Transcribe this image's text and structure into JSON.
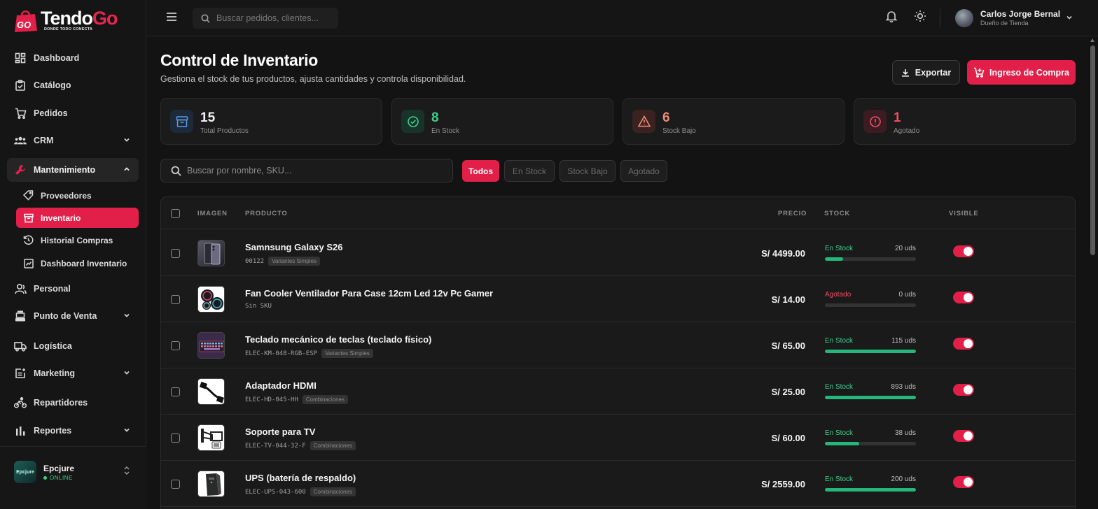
{
  "brand": {
    "name_part1": "Tendo",
    "name_part2": "Go",
    "badge": "GO",
    "tagline": "DONDE TODO CONECTA"
  },
  "sidebar": {
    "items": [
      {
        "label": "Dashboard"
      },
      {
        "label": "Catálogo"
      },
      {
        "label": "Pedidos"
      },
      {
        "label": "CRM"
      },
      {
        "label": "Mantenimiento"
      },
      {
        "label": "Proveedores"
      },
      {
        "label": "Inventario"
      },
      {
        "label": "Historial Compras"
      },
      {
        "label": "Dashboard Inventario"
      },
      {
        "label": "Personal"
      },
      {
        "label": "Punto de Venta"
      },
      {
        "label": "Logística"
      },
      {
        "label": "Marketing"
      },
      {
        "label": "Repartidores"
      },
      {
        "label": "Reportes"
      }
    ],
    "store": {
      "name": "Epcjure",
      "status": "ONLINE",
      "avatar_text": "Epcjure"
    }
  },
  "topbar": {
    "search_placeholder": "Buscar pedidos, clientes...",
    "user": {
      "name": "Carlos Jorge Bernal",
      "role": "Dueño de Tienda"
    }
  },
  "page": {
    "title": "Control de Inventario",
    "subtitle": "Gestiona el stock de tus productos, ajusta cantidades y controla disponibilidad.",
    "export_label": "Exportar",
    "purchase_label": "Ingreso de Compra"
  },
  "stats": [
    {
      "value": "15",
      "label": "Total Productos",
      "color": "#f2f2f2"
    },
    {
      "value": "8",
      "label": "En Stock",
      "color": "#3fcf8e"
    },
    {
      "value": "6",
      "label": "Stock Bajo",
      "color": "#f08a7a"
    },
    {
      "value": "1",
      "label": "Agotado",
      "color": "#ef4f5f"
    }
  ],
  "filters": {
    "search_placeholder": "Buscar por nombre, SKU...",
    "chips": [
      "Todos",
      "En Stock",
      "Stock Bajo",
      "Agotado"
    ]
  },
  "table": {
    "headers": {
      "image": "IMAGEN",
      "product": "PRODUCTO",
      "price": "PRECIO",
      "stock": "STOCK",
      "visible": "VISIBLE"
    },
    "rows": [
      {
        "name": "Samnsung Galaxy S26",
        "sku": "00122",
        "tag": "Variantes Simples",
        "price": "S/ 4499.00",
        "status": "En Stock",
        "units": "20 uds",
        "level": 0.2,
        "visible": true
      },
      {
        "name": "Fan Cooler Ventilador Para Case 12cm Led 12v Pc Gamer",
        "sku": "Sin SKU",
        "tag": "",
        "price": "S/ 14.00",
        "status": "Agotado",
        "units": "0 uds",
        "level": 0,
        "visible": true
      },
      {
        "name": "Teclado mecánico de teclas (teclado físico)",
        "sku": "ELEC-KM-048-RGB-ESP",
        "tag": "Variantes Simples",
        "price": "S/ 65.00",
        "status": "En Stock",
        "units": "115 uds",
        "level": 1,
        "visible": true
      },
      {
        "name": "Adaptador HDMI",
        "sku": "ELEC-HD-045-HH",
        "tag": "Combinaciones",
        "price": "S/ 25.00",
        "status": "En Stock",
        "units": "893 uds",
        "level": 1,
        "visible": true
      },
      {
        "name": "Soporte para TV",
        "sku": "ELEC-TV-044-32-F",
        "tag": "Combinaciones",
        "price": "S/ 60.00",
        "status": "En Stock",
        "units": "38 uds",
        "level": 0.38,
        "visible": true
      },
      {
        "name": "UPS (batería de respaldo)",
        "sku": "ELEC-UPS-043-600",
        "tag": "Combinaciones",
        "price": "S/ 2559.00",
        "status": "En Stock",
        "units": "200 uds",
        "level": 1,
        "visible": true
      }
    ]
  },
  "colors": {
    "accent": "#e21f49",
    "in_stock": "#3fcf8e",
    "out_of_stock": "#ef4f5f"
  }
}
